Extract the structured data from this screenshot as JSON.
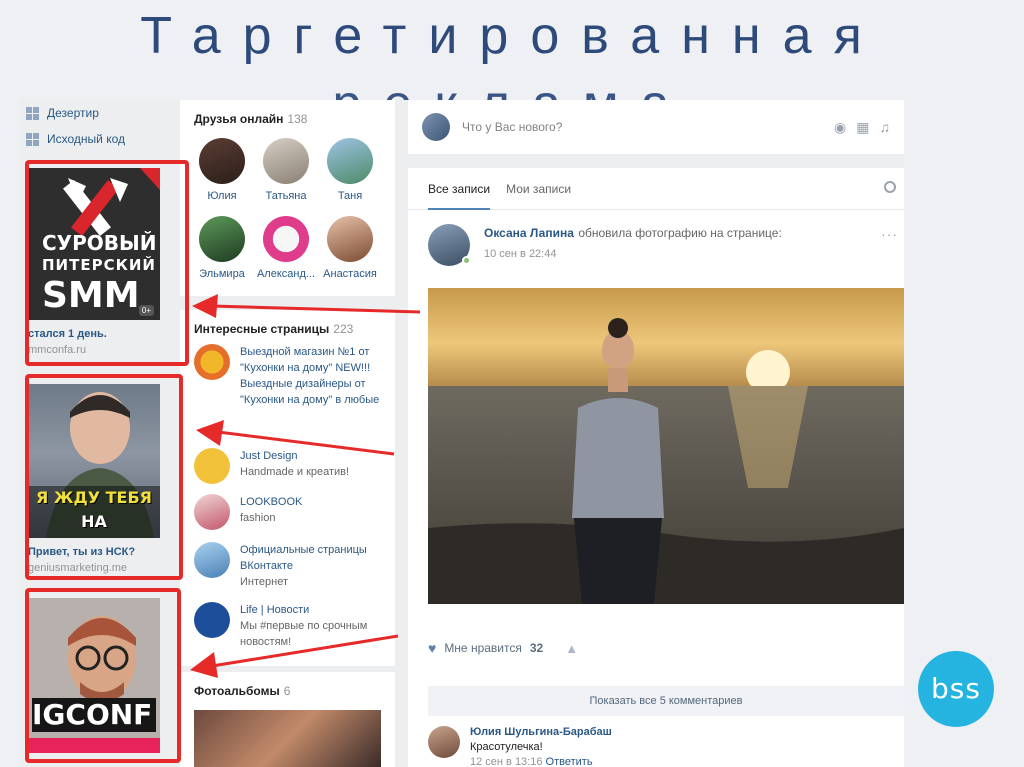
{
  "slide": {
    "title_line1": "Таргетированная",
    "title_line2": "реклама"
  },
  "left_menu": [
    {
      "label": "Дезертир"
    },
    {
      "label": "Исходный код"
    }
  ],
  "ads": [
    {
      "image_text_1": "СУРОВЫЙ",
      "image_text_2": "ПИТЕРСКИЙ",
      "image_text_3": "SMM",
      "age_badge": "0+",
      "caption": "стался 1 день.",
      "url": "mmconfa.ru"
    },
    {
      "image_text_1": "Я ЖДУ ТЕБЯ",
      "image_text_2": "НА ИНТЕНСИВЕ",
      "caption": "Привет, ты из НСК?",
      "url": "geniusmarketing.me"
    },
    {
      "image_text_1": "IGCONF"
    }
  ],
  "friends_block": {
    "title": "Друзья онлайн",
    "count": "138",
    "friends": [
      {
        "name": "Юлия"
      },
      {
        "name": "Татьяна"
      },
      {
        "name": "Таня"
      },
      {
        "name": "Эльмира"
      },
      {
        "name": "Александ..."
      },
      {
        "name": "Анастасия"
      }
    ]
  },
  "pages_block": {
    "title": "Интересные страницы",
    "count": "223",
    "pages": [
      {
        "name": "Выездной магазин №1 от \"Кухонки на дому\" NEW!!! Выездные дизайнеры от \"Кухонки на дому\" в любые",
        "desc": ""
      },
      {
        "name": "Just Design",
        "desc": "Handmade и креатив!"
      },
      {
        "name": "LOOKBOOK",
        "desc": "fashion"
      },
      {
        "name": "Официальные страницы ВКонтакте",
        "desc": "Интернет"
      },
      {
        "name": "Life | Новости",
        "desc": "Мы #первые по срочным новостям!"
      }
    ]
  },
  "albums_block": {
    "title": "Фотоальбомы",
    "count": "6"
  },
  "feed": {
    "new_post_placeholder": "Что у Вас нового?",
    "tabs": [
      {
        "label": "Все записи",
        "active": true
      },
      {
        "label": "Мои записи",
        "active": false
      }
    ],
    "post": {
      "author": "Оксана Лапина",
      "action": "обновила фотографию на странице:",
      "date": "10 сен в 22:44",
      "likes_label": "Мне нравится",
      "likes_count": "32",
      "show_comments": "Показать все 5 комментариев",
      "comment": {
        "author": "Юлия Шульгина-Барабаш",
        "text": "Красотулечка!",
        "date": "12 сен в 13:16",
        "reply": "Ответить"
      }
    }
  },
  "logo": {
    "text": "bss"
  },
  "colors": {
    "vk_link": "#2a5885",
    "highlight_red": "#e62a2a",
    "title_blue": "#2d4a7a",
    "logo_blue": "#25b3df"
  }
}
